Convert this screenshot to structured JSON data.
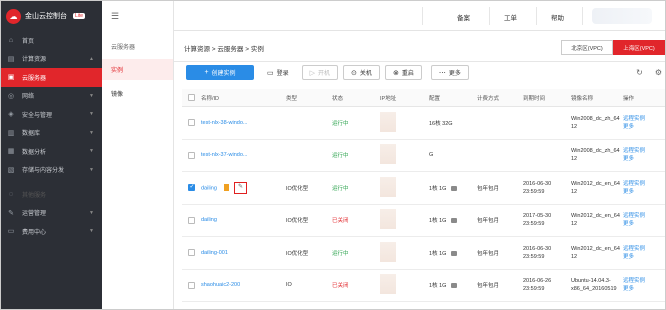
{
  "brand": {
    "name": "金山云控制台",
    "badge": "Lite"
  },
  "sidebar": {
    "items": [
      {
        "icon": "home",
        "label": "首页"
      },
      {
        "icon": "compute",
        "label": "计算资源"
      },
      {
        "icon": "cloud",
        "label": "云服务器"
      },
      {
        "icon": "network",
        "label": "网络"
      },
      {
        "icon": "security",
        "label": "安全与管理"
      },
      {
        "icon": "database",
        "label": "数据库"
      },
      {
        "icon": "analytics",
        "label": "数据分析"
      },
      {
        "icon": "storage",
        "label": "存储与内容分发"
      },
      {
        "icon": "misc",
        "label": "其他服务"
      },
      {
        "icon": "ops",
        "label": "运营管理"
      },
      {
        "icon": "billing",
        "label": "费用中心"
      }
    ]
  },
  "subnav": {
    "title": "云服务器",
    "items": [
      "实例",
      "镜像"
    ]
  },
  "topbar": {
    "links": [
      "备案",
      "工单",
      "帮助"
    ]
  },
  "breadcrumb": "计算资源 > 云服务器 > 实例",
  "region_tabs": [
    "北京区(VPC)",
    "上海区(VPC)"
  ],
  "toolbar": {
    "create": "创建实例",
    "buttons": [
      {
        "icon": "login",
        "label": "登录"
      },
      {
        "icon": "power-on",
        "label": "开机"
      },
      {
        "icon": "power-off",
        "label": "关机"
      },
      {
        "icon": "restart",
        "label": "重启"
      },
      {
        "icon": "more",
        "label": "更多"
      }
    ]
  },
  "table": {
    "headers": [
      "名称/ID",
      "类型",
      "状态",
      "IP地址",
      "配置",
      "计费方式",
      "到期时间",
      "镜像名称",
      "操作"
    ],
    "rows": [
      {
        "name": "test-nlx-38-windo...",
        "type": "",
        "status": "运行中",
        "cfg": "16核 32G",
        "bill": "",
        "exp": "",
        "os": "Win2008_dc_zh_64bit_201604 12",
        "op1": "远程实例",
        "op2": "更多"
      },
      {
        "name": "test-nlx-37-windo...",
        "type": "",
        "status": "运行中",
        "cfg": "G",
        "bill": "",
        "exp": "",
        "os": "Win2008_dc_zh_64bit_201604 12",
        "op1": "远程实例",
        "op2": "更多"
      },
      {
        "name": "dailing",
        "type": "IO优化型",
        "status": "运行中",
        "cfg": "1核 1G",
        "bill": "包年包月",
        "exp": "2016-06-30 23:59:59",
        "os": "Win2012_dc_en_64bit_201604 12",
        "op1": "远程实例",
        "op2": "更多"
      },
      {
        "name": "dailing",
        "type": "IO优化型",
        "status": "已关闭",
        "cfg": "1核 1G",
        "bill": "包年包月",
        "exp": "2017-05-30 23:59:59",
        "os": "Win2012_dc_en_64bit_201604 12",
        "op1": "远程实例",
        "op2": "更多"
      },
      {
        "name": "dailing-001",
        "type": "IO优化型",
        "status": "运行中",
        "cfg": "1核 1G",
        "bill": "包年包月",
        "exp": "2016-06-30 23:59:59",
        "os": "Win2012_dc_en_64bit_201604 12",
        "op1": "远程实例",
        "op2": "更多"
      },
      {
        "name": "shaohuaic2-200",
        "type": "IO",
        "status": "已关闭",
        "cfg": "1核 1G",
        "bill": "包年包月",
        "exp": "2016-06-26 23:59:59",
        "os": "Ubuntu-14.04.3-x86_64_20160519",
        "op1": "远程实例",
        "op2": "更多"
      }
    ]
  }
}
